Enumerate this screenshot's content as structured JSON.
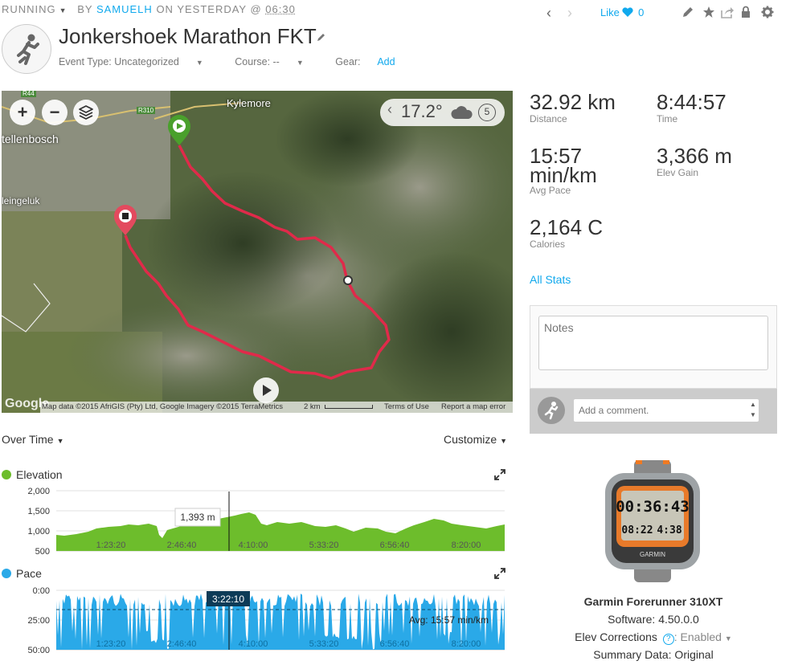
{
  "header": {
    "activity_type": "RUNNING",
    "by": "BY",
    "user": "SAMUELH",
    "on": "ON YESTERDAY @",
    "time": "06:30",
    "title": "Jonkershoek Marathon FKT",
    "event_type_label": "Event Type: Uncategorized",
    "course_label": "Course: --",
    "gear_label": "Gear:",
    "gear_add": "Add"
  },
  "actions": {
    "like_label": "Like",
    "like_count": "0"
  },
  "map": {
    "labels": {
      "kylemore": "Kylemore",
      "stellenbosch": "tellenbosch",
      "kleingeluk": "leingeluk",
      "r44": "R44",
      "r310": "R310"
    },
    "weather_temp": "17.2°",
    "weather_wind": "5",
    "attribution": "Map data ©2015 AfriGIS (Pty) Ltd, Google Imagery ©2015 TerraMetrics",
    "scale": "2 km",
    "terms": "Terms of Use",
    "report": "Report a map error",
    "google": "Google"
  },
  "charts": {
    "mode_label": "Over Time",
    "customize_label": "Customize",
    "elevation": {
      "legend": "Elevation",
      "color": "#6dbd2c",
      "y_ticks": [
        "2,000",
        "1,500",
        "1,000",
        "500"
      ],
      "x_ticks": [
        "1:23:20",
        "2:46:40",
        "4:10:00",
        "5:33:20",
        "6:56:40",
        "8:20:00"
      ],
      "tooltip": "1,393 m"
    },
    "pace": {
      "legend": "Pace",
      "color": "#2aa9e8",
      "y_ticks": [
        "0:00",
        "25:00",
        "50:00"
      ],
      "x_ticks": [
        "1:23:20",
        "2:46:40",
        "4:10:00",
        "5:33:20",
        "6:56:40",
        "8:20:00"
      ],
      "cursor_time": "3:22:10",
      "avg_label": "Avg: 15:57 min/km"
    }
  },
  "stats": {
    "distance": {
      "value": "32.92 km",
      "label": "Distance"
    },
    "time": {
      "value": "8:44:57",
      "label": "Time"
    },
    "pace": {
      "value1": "15:57",
      "value2": "min/km",
      "label": "Avg Pace"
    },
    "elev_gain": {
      "value": "3,366 m",
      "label": "Elev Gain"
    },
    "calories": {
      "value": "2,164 C",
      "label": "Calories"
    },
    "all_stats": "All Stats"
  },
  "notes": {
    "placeholder": "Notes"
  },
  "comment": {
    "placeholder": "Add a comment."
  },
  "device": {
    "name": "Garmin Forerunner 310XT",
    "software": "Software: 4.50.0.0",
    "elev_label": "Elev Corrections",
    "elev_value": ": Enabled",
    "summary": "Summary Data: Original",
    "screen_main": "00:36:43",
    "screen_left": "08:22",
    "screen_right": "4:38",
    "brand": "GARMIN"
  }
}
